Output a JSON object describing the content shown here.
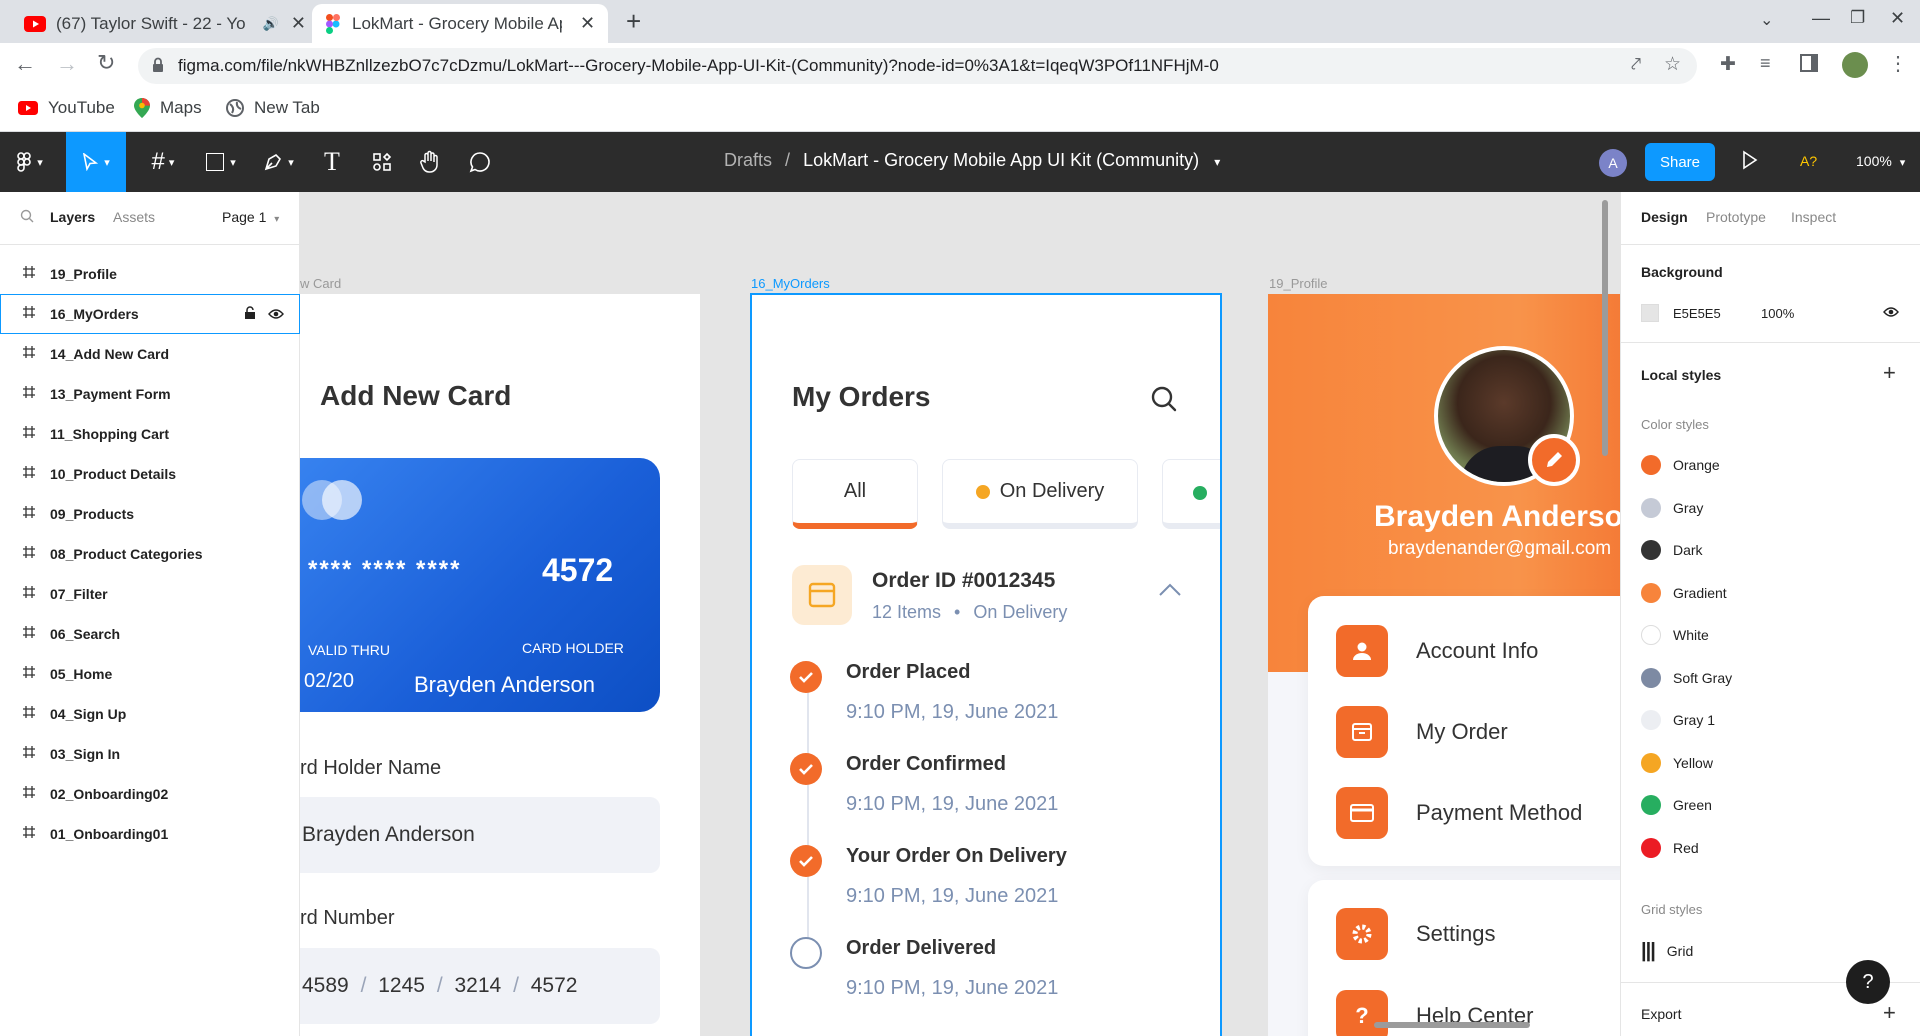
{
  "browser": {
    "tabs": [
      {
        "title": "(67) Taylor Swift - 22 - Yo",
        "icon": "youtube-icon"
      },
      {
        "title": "LokMart - Grocery Mobile Ap",
        "icon": "figma-icon"
      }
    ],
    "url": "figma.com/file/nkWHBZnllzezbO7c7cDzmu/LokMart---Grocery-Mobile-App-UI-Kit-(Community)?node-id=0%3A1&t=IqeqW3POf11NFHjM-0",
    "bookmarks": [
      {
        "label": "YouTube",
        "icon": "youtube-icon"
      },
      {
        "label": "Maps",
        "icon": "maps-icon"
      },
      {
        "label": "New Tab",
        "icon": "globe-icon"
      }
    ]
  },
  "toolbar": {
    "breadcrumb_root": "Drafts",
    "separator": "/",
    "doc_title": "LokMart - Grocery Mobile App UI Kit (Community)",
    "avatar_letter": "A",
    "share_label": "Share",
    "font_warning": "A?",
    "zoom": "100%"
  },
  "left_panel": {
    "tabs": [
      "Layers",
      "Assets"
    ],
    "page": "Page 1",
    "layers": [
      "19_Profile",
      "16_MyOrders",
      "14_Add New Card",
      "13_Payment Form",
      "11_Shopping Cart",
      "10_Product Details",
      "09_Products",
      "08_Product Categories",
      "07_Filter",
      "06_Search",
      "05_Home",
      "04_Sign Up",
      "03_Sign In",
      "02_Onboarding02",
      "01_Onboarding01"
    ],
    "selected_layer": "16_MyOrders"
  },
  "right_panel": {
    "tabs": [
      "Design",
      "Prototype",
      "Inspect"
    ],
    "background_title": "Background",
    "background_hex": "E5E5E5",
    "background_opacity": "100%",
    "local_styles_title": "Local styles",
    "color_styles_title": "Color styles",
    "color_styles": [
      {
        "name": "Orange",
        "color": "#f26b2a"
      },
      {
        "name": "Gray",
        "color": "#c5cad6"
      },
      {
        "name": "Dark",
        "color": "#333333"
      },
      {
        "name": "Gradient",
        "color": "#f7843b"
      },
      {
        "name": "White",
        "color": "#ffffff"
      },
      {
        "name": "Soft Gray",
        "color": "#7d8aa3"
      },
      {
        "name": "Gray 1",
        "color": "#eceef2"
      },
      {
        "name": "Yellow",
        "color": "#f5a623"
      },
      {
        "name": "Green",
        "color": "#27ae60"
      },
      {
        "name": "Red",
        "color": "#eb1c24"
      }
    ],
    "grid_styles_title": "Grid styles",
    "grid_style": "Grid",
    "export_title": "Export"
  },
  "canvas": {
    "frame_labels": {
      "add_card": "w Card",
      "my_orders": "16_MyOrders",
      "profile": "19_Profile"
    },
    "add_card": {
      "title": "Add New Card",
      "card_mask": "**** **** ****",
      "card_last4": "4572",
      "valid_thru_label": "VALID THRU",
      "valid_thru": "02/20",
      "card_holder_label": "CARD HOLDER",
      "card_holder": "Brayden Anderson",
      "holder_field_label": "rd Holder Name",
      "holder_field_value": "Brayden Anderson",
      "number_field_label": "rd Number",
      "number_parts": [
        "4589",
        "1245",
        "3214",
        "4572"
      ]
    },
    "my_orders": {
      "title": "My Orders",
      "filters": [
        "All",
        "On Delivery"
      ],
      "order_id": "Order ID #0012345",
      "items": "12 Items",
      "status": "On Delivery",
      "timeline": [
        {
          "title": "Order Placed",
          "time": "9:10 PM, 19, June 2021",
          "done": true
        },
        {
          "title": "Order Confirmed",
          "time": "9:10 PM, 19, June 2021",
          "done": true
        },
        {
          "title": "Your Order On Delivery",
          "time": "9:10 PM, 19, June 2021",
          "done": true
        },
        {
          "title": "Order Delivered",
          "time": "9:10 PM, 19, June 2021",
          "done": false
        }
      ]
    },
    "profile": {
      "name": "Brayden Anderson",
      "email": "braydenander@gmail.com",
      "menu": [
        "Account Info",
        "My Order",
        "Payment Method",
        "Settings",
        "Help Center"
      ]
    }
  },
  "help_button": "?",
  "colors": {
    "accent": "#0d99ff",
    "brand_orange": "#f26b2a",
    "toolbar_bg": "#2c2c2c"
  }
}
